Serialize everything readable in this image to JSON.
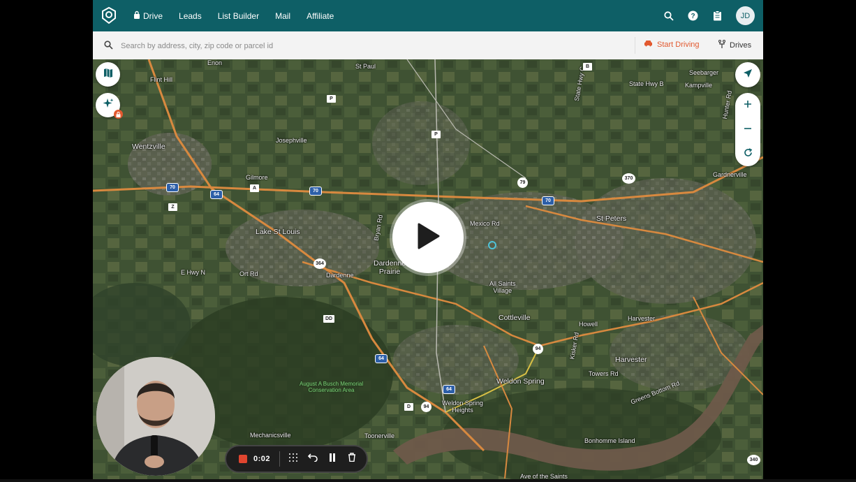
{
  "nav": {
    "items": [
      "Drive",
      "Leads",
      "List Builder",
      "Mail",
      "Affiliate"
    ],
    "avatar_initials": "JD",
    "bg_color": "#0e5f66"
  },
  "search": {
    "placeholder": "Search by address, city, zip code or parcel id",
    "start_driving_label": "Start Driving",
    "drives_label": "Drives",
    "start_driving_color": "#e2592f"
  },
  "map": {
    "labels": {
      "enon": "Enon",
      "st_paul": "St Paul",
      "flint_hill": "Flint Hill",
      "wentzville": "Wentzville",
      "josephville": "Josephville",
      "gilmore": "Gilmore",
      "lake_st_louis": "Lake St Louis",
      "dardenne_prairie": "Dardenne\nPrairie",
      "dardenne": "Dardenne",
      "ort_rd": "Ort Rd",
      "e_hwy_n": "E Hwy N",
      "mexico_rd": "Mexico Rd",
      "all_saints_village": "All Saints\nVillage",
      "cottleville": "Cottleville",
      "st_peters": "St Peters",
      "howell": "Howell",
      "harvester_north": "Harvester",
      "harvester": "Harvester",
      "towers_rd": "Towers Rd",
      "greens_bottom_rd": "Greens Bottom Rd",
      "weldon_spring": "Weldon Spring",
      "weldon_spring_heights": "Weldon Spring\nHeights",
      "busch": "August A Busch Memorial\nConservation Area",
      "mechanicsville": "Mechanicsville",
      "toonerville": "Toonerville",
      "bonhomme_island": "Bonhomme Island",
      "seebarger": "Seebarger",
      "kampville": "Kampville",
      "state_hwy_b": "State Hwy B",
      "state_hwy_c": "State Hwy C",
      "gardnerville": "Gardnerville",
      "hunter_rd": "Hunter Rd",
      "ave_of_saints": "Ave of the Saints",
      "kisker_rd": "Kisker Rd",
      "bryan_rd": "Bryan Rd"
    },
    "shields": {
      "i70_a": "70",
      "i70_b": "70",
      "i70_c": "70",
      "i64_a": "64",
      "i64_b": "64",
      "i64_c": "64",
      "i64_d": "64",
      "r79": "79",
      "r364": "364",
      "r94_a": "94",
      "r94_b": "94",
      "r370": "370",
      "r340": "340",
      "a": "A",
      "z": "Z",
      "p_a": "P",
      "p_b": "P",
      "dd": "DD",
      "d": "D",
      "b": "B"
    }
  },
  "recorder": {
    "time": "0:02",
    "stop_color": "#e0452f"
  }
}
